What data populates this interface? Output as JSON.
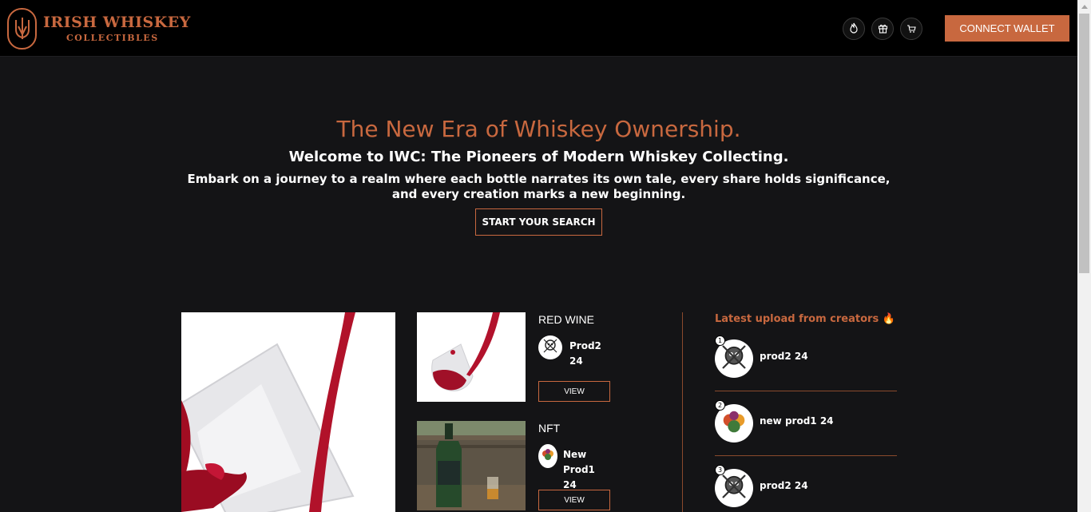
{
  "brand": {
    "title": "IRISH WHISKEY",
    "subtitle": "COLLECTIBLES"
  },
  "header": {
    "icons": [
      "fire-icon",
      "gift-icon",
      "cart-icon"
    ],
    "connect_wallet_label": "CONNECT WALLET"
  },
  "hero": {
    "title": "The New Era of Whiskey Ownership.",
    "subtitle": "Welcome to IWC: The Pioneers of Modern Whiskey Collecting.",
    "description": "Embark on a journey to a realm where each bottle narrates its own tale, every share holds significance, and every creation marks a new beginning.",
    "cta_label": "START YOUR SEARCH"
  },
  "cards": [
    {
      "title": "RED WINE",
      "creator": "Prod2 24",
      "view_label": "VIEW"
    },
    {
      "title": "NFT",
      "creator": "New Prod1 24",
      "view_label": "VIEW"
    }
  ],
  "latest": {
    "title": "Latest upload from creators 🔥",
    "items": [
      {
        "rank": "1",
        "name": "prod2 24"
      },
      {
        "rank": "2",
        "name": "new prod1 24"
      },
      {
        "rank": "3",
        "name": "prod2 24"
      }
    ]
  },
  "colors": {
    "accent": "#c8683f",
    "background": "#141416",
    "header": "#000000"
  }
}
